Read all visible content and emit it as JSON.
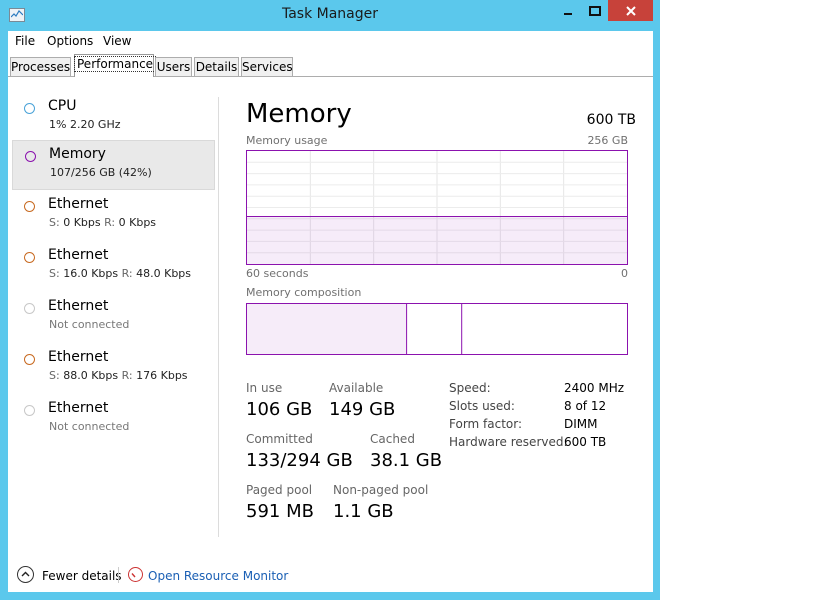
{
  "window": {
    "title": "Task Manager"
  },
  "menu": [
    {
      "label": "File"
    },
    {
      "label": "Options"
    },
    {
      "label": "View"
    }
  ],
  "tabs": [
    {
      "label": "Processes"
    },
    {
      "label": "Performance"
    },
    {
      "label": "Users"
    },
    {
      "label": "Details"
    },
    {
      "label": "Services"
    }
  ],
  "sidebar": {
    "items": [
      {
        "title": "CPU",
        "sub": "1%  2.20 GHz",
        "color": "#4aa3d8"
      },
      {
        "title": "Memory",
        "sub": "107/256 GB (42%)",
        "color": "#8b12ae"
      },
      {
        "title": "Ethernet",
        "s_label": "S:",
        "s_val": "0 Kbps",
        "r_label": "R:",
        "r_val": "0 Kbps",
        "color": "#c86a21"
      },
      {
        "title": "Ethernet",
        "s_label": "S:",
        "s_val": "16.0 Kbps",
        "r_label": "R:",
        "r_val": "48.0 Kbps",
        "color": "#c86a21"
      },
      {
        "title": "Ethernet",
        "sub": "Not connected",
        "color": "#c8c8c8"
      },
      {
        "title": "Ethernet",
        "s_label": "S:",
        "s_val": "88.0 Kbps",
        "r_label": "R:",
        "r_val": "176 Kbps",
        "color": "#c86a21"
      },
      {
        "title": "Ethernet",
        "sub": "Not connected",
        "color": "#c8c8c8"
      }
    ]
  },
  "memory": {
    "heading": "Memory",
    "total": "600 TB",
    "usage_label": "Memory usage",
    "usage_max": "256 GB",
    "time_left": "60 seconds",
    "time_right": "0",
    "usage_fraction": 0.42,
    "composition_label": "Memory composition",
    "composition_in_use_fraction": 0.42,
    "composition_standby_fraction": 0.145,
    "accent_color": "#8b12ae",
    "stats": {
      "in_use_label": "In use",
      "in_use_value": "106 GB",
      "available_label": "Available",
      "available_value": "149 GB",
      "committed_label": "Committed",
      "committed_value": "133/294 GB",
      "cached_label": "Cached",
      "cached_value": "38.1 GB",
      "paged_label": "Paged pool",
      "paged_value": "591 MB",
      "nonpaged_label": "Non-paged pool",
      "nonpaged_value": "1.1 GB"
    },
    "specs": [
      {
        "label": "Speed:",
        "value": "2400 MHz"
      },
      {
        "label": "Slots used:",
        "value": "8 of 12"
      },
      {
        "label": "Form factor:",
        "value": "DIMM"
      },
      {
        "label": "Hardware reserved:",
        "value": "600 TB"
      }
    ]
  },
  "footer": {
    "fewer_details": "Fewer details",
    "open_resource_monitor": "Open Resource Monitor",
    "fewer_icon": "chevron-up-icon",
    "monitor_icon": "resource-monitor-icon"
  }
}
